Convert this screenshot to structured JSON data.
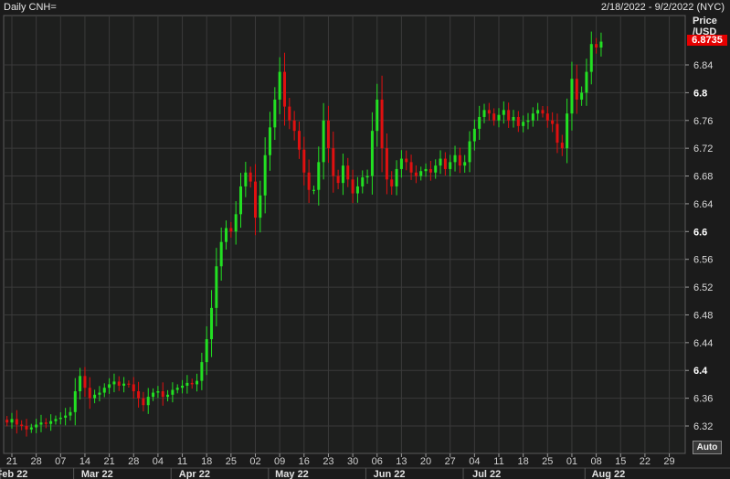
{
  "header": {
    "title": "Daily CNH=",
    "range": "2/18/2022 - 9/2/2022 (NYC)"
  },
  "axis": {
    "price_label": "Price\n/USD",
    "last_value": "6.8735",
    "auto_label": "Auto"
  },
  "colors": {
    "up": "#22e022",
    "down": "#e01010",
    "grid": "#3a3a3a",
    "background": "#1b1b1b",
    "last_tag": "#e60000"
  },
  "chart_data": {
    "type": "candlestick",
    "ylim": [
      6.285,
      6.925
    ],
    "y_ticks": [
      {
        "label": "6.84",
        "v": 6.84,
        "bold": false
      },
      {
        "label": "6.8",
        "v": 6.8,
        "bold": true
      },
      {
        "label": "6.76",
        "v": 6.76,
        "bold": false
      },
      {
        "label": "6.72",
        "v": 6.72,
        "bold": false
      },
      {
        "label": "6.68",
        "v": 6.68,
        "bold": false
      },
      {
        "label": "6.64",
        "v": 6.64,
        "bold": false
      },
      {
        "label": "6.6",
        "v": 6.6,
        "bold": true
      },
      {
        "label": "6.56",
        "v": 6.56,
        "bold": false
      },
      {
        "label": "6.52",
        "v": 6.52,
        "bold": false
      },
      {
        "label": "6.48",
        "v": 6.48,
        "bold": false
      },
      {
        "label": "6.44",
        "v": 6.44,
        "bold": false
      },
      {
        "label": "6.4",
        "v": 6.4,
        "bold": true
      },
      {
        "label": "6.36",
        "v": 6.36,
        "bold": false
      },
      {
        "label": "6.32",
        "v": 6.32,
        "bold": false
      }
    ],
    "x_ticks": [
      "21",
      "28",
      "07",
      "14",
      "21",
      "28",
      "04",
      "11",
      "18",
      "25",
      "02",
      "09",
      "16",
      "23",
      "30",
      "06",
      "13",
      "20",
      "27",
      "04",
      "11",
      "18",
      "25",
      "01",
      "08",
      "15",
      "22",
      "29"
    ],
    "month_labels": [
      {
        "label": "Feb 22",
        "tick_index": 0
      },
      {
        "label": "Mar 22",
        "tick_index": 3
      },
      {
        "label": "Apr 22",
        "tick_index": 7
      },
      {
        "label": "May 22",
        "tick_index": 11
      },
      {
        "label": "Jun 22",
        "tick_index": 15
      },
      {
        "label": "Jul 22",
        "tick_index": 19
      },
      {
        "label": "Aug 22",
        "tick_index": 24
      }
    ],
    "first_day_index": -1,
    "candles": [
      6.325,
      6.33,
      6.322,
      6.32,
      6.315,
      6.318,
      6.322,
      6.325,
      6.323,
      6.327,
      6.33,
      6.332,
      6.335,
      6.34,
      6.37,
      6.392,
      6.375,
      6.36,
      6.365,
      6.368,
      6.375,
      6.38,
      6.384,
      6.378,
      6.381,
      6.38,
      6.37,
      6.36,
      6.35,
      6.362,
      6.368,
      6.37,
      6.362,
      6.365,
      6.372,
      6.375,
      6.378,
      6.382,
      6.38,
      6.385,
      6.412,
      6.445,
      6.49,
      6.55,
      6.585,
      6.605,
      6.6,
      6.625,
      6.665,
      6.685,
      6.672,
      6.62,
      6.652,
      6.71,
      6.75,
      6.79,
      6.83,
      6.78,
      6.76,
      6.745,
      6.718,
      6.685,
      6.66,
      6.66,
      6.7,
      6.76,
      6.72,
      6.68,
      6.67,
      6.695,
      6.675,
      6.655,
      6.665,
      6.678,
      6.68,
      6.745,
      6.79,
      6.72,
      6.675,
      6.665,
      6.69,
      6.705,
      6.7,
      6.685,
      6.68,
      6.687,
      6.69,
      6.685,
      6.695,
      6.705,
      6.69,
      6.7,
      6.71,
      6.695,
      6.7,
      6.73,
      6.748,
      6.765,
      6.775,
      6.77,
      6.76,
      6.768,
      6.775,
      6.76,
      6.765,
      6.752,
      6.758,
      6.76,
      6.77,
      6.775,
      6.77,
      6.76,
      6.755,
      6.728,
      6.72,
      6.77,
      6.82,
      6.79,
      6.8,
      6.83,
      6.87,
      6.865,
      6.8735
    ]
  }
}
